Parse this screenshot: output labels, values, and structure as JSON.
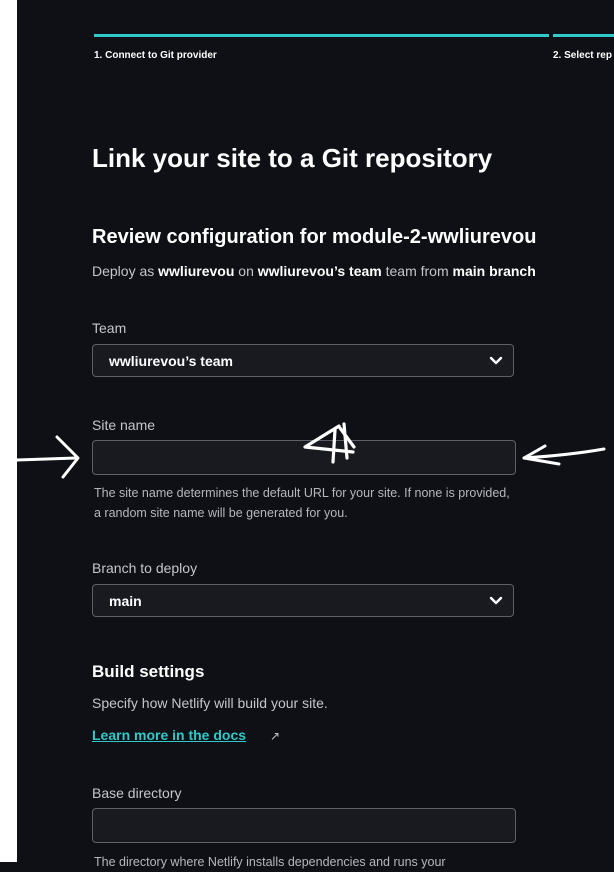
{
  "stepper": {
    "step1": "1. Connect to Git provider",
    "step2": "2. Select rep"
  },
  "page_title": "Link your site to a Git repository",
  "review": {
    "title": "Review configuration for module-2-wwliurevou",
    "deploy_prefix": "Deploy as",
    "user": "wwliurevou",
    "on": "on",
    "team_name": "wwliurevou’s team",
    "team_word": "team from",
    "branch_bold": "main branch"
  },
  "team_field": {
    "label": "Team",
    "value": "wwliurevou’s team"
  },
  "site_name_field": {
    "label": "Site name",
    "value": "",
    "help": "The site name determines the default URL for your site. If none is provided, a random site name will be generated for you."
  },
  "branch_field": {
    "label": "Branch to deploy",
    "value": "main"
  },
  "build_settings": {
    "title": "Build settings",
    "description": "Specify how Netlify will build your site.",
    "docs_link": "Learn more in the docs",
    "external_icon": "external-link-icon"
  },
  "base_directory": {
    "label": "Base directory",
    "value": "",
    "help_partial": "The directory where Netlify installs dependencies and runs your"
  },
  "colors": {
    "background": "#0e1015",
    "accent": "#30c8c9",
    "input_bg": "#181a20",
    "border": "#5c6069"
  }
}
